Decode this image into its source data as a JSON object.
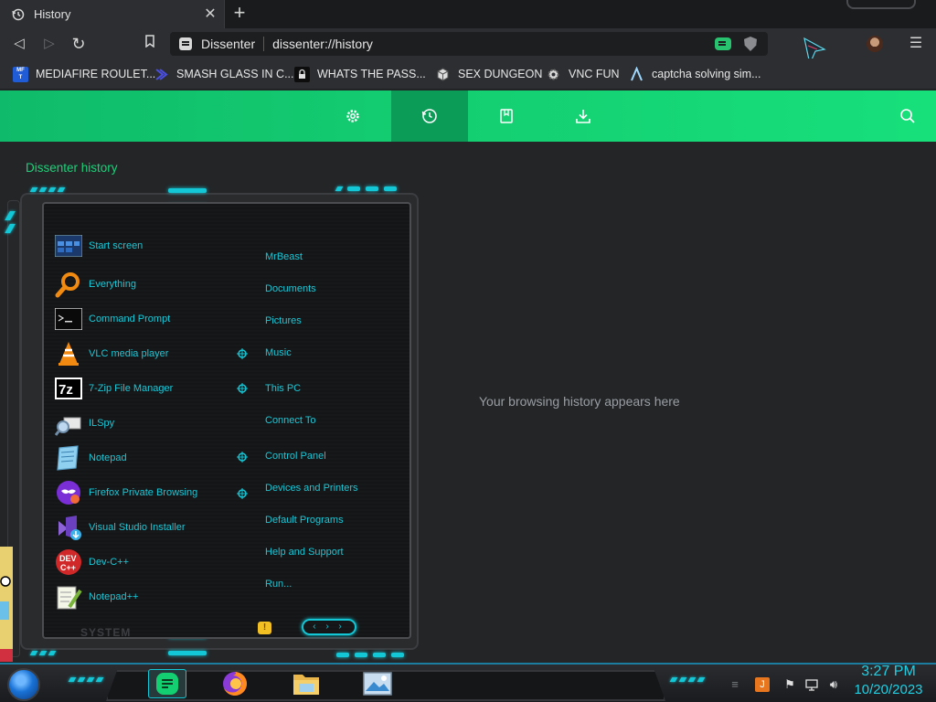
{
  "tab": {
    "title": "History",
    "close_glyph": "✕",
    "icon": "history-icon"
  },
  "new_tab_glyph": "+",
  "nav": {
    "back": "◁",
    "forward": "▷",
    "reload": "↻",
    "bookmark": "bookmark-icon"
  },
  "address": {
    "site_name": "Dissenter",
    "url": "dissenter://history"
  },
  "menu_glyph": "☰",
  "bookmarks": [
    {
      "label": "MEDIAFIRE ROULET...",
      "icon": "mediafire-icon",
      "icon_text": "MF\nT",
      "color": "#1f5cd6"
    },
    {
      "label": "SMASH GLASS IN C...",
      "icon": "visual-studio-icon",
      "icon_text": "",
      "color": "#3b3fd1"
    },
    {
      "label": "WHATS THE PASS...",
      "icon": "lock-icon",
      "icon_text": "",
      "color": "#111111"
    },
    {
      "label": "SEX DUNGEON",
      "icon": "cube-icon",
      "icon_text": "",
      "color": "#d9d9d9"
    },
    {
      "label": "VNC FUN",
      "icon": "gear-icon",
      "icon_text": "",
      "color": "#d9d9d9"
    },
    {
      "label": "captcha solving sim...",
      "icon": "a-logo-icon",
      "icon_text": "",
      "color": "#9fd8ff"
    }
  ],
  "green_nav": [
    {
      "name": "settings",
      "icon": "gear-icon",
      "active": false
    },
    {
      "name": "history",
      "icon": "history-icon",
      "active": true
    },
    {
      "name": "bookmarks",
      "icon": "bookmark-icon",
      "active": false
    },
    {
      "name": "downloads",
      "icon": "download-icon",
      "active": false
    }
  ],
  "page": {
    "heading": "Dissenter history",
    "empty_message": "Your browsing history appears here"
  },
  "start_menu": {
    "programs": [
      {
        "label": "Start screen",
        "icon": "start-screen-icon"
      },
      {
        "label": "Everything",
        "icon": "magnifier-icon"
      },
      {
        "label": "Command Prompt",
        "icon": "terminal-icon"
      },
      {
        "label": "VLC media player",
        "icon": "vlc-cone-icon"
      },
      {
        "label": "7-Zip File Manager",
        "icon": "7zip-icon"
      },
      {
        "label": "ILSpy",
        "icon": "ilspy-icon"
      },
      {
        "label": "Notepad",
        "icon": "notepad-icon"
      },
      {
        "label": "Firefox Private Browsing",
        "icon": "firefox-private-icon"
      },
      {
        "label": "Visual Studio Installer",
        "icon": "visual-studio-installer-icon"
      },
      {
        "label": "Dev-C++",
        "icon": "devcpp-icon"
      },
      {
        "label": "Notepad++",
        "icon": "notepadpp-icon"
      }
    ],
    "places": [
      {
        "label": "MrBeast",
        "has_arrow": false
      },
      {
        "label": "Documents",
        "has_arrow": false
      },
      {
        "label": "Pictures",
        "has_arrow": false
      },
      {
        "label": "Music",
        "has_arrow": true
      },
      {
        "label": "This PC",
        "has_arrow": true
      },
      {
        "label": "Connect To",
        "has_arrow": false
      },
      {
        "label": "Control Panel",
        "has_arrow": true
      },
      {
        "label": "Devices and Printers",
        "has_arrow": true
      },
      {
        "label": "Default Programs",
        "has_arrow": false
      },
      {
        "label": "Help and Support",
        "has_arrow": false
      },
      {
        "label": "Run...",
        "has_arrow": false
      }
    ],
    "system_label": "SYSTEM",
    "power_glyph": "!",
    "nav_glyphs": "‹ › ›"
  },
  "taskbar": {
    "apps": [
      {
        "name": "dissenter",
        "icon": "dissenter-icon",
        "active": true
      },
      {
        "name": "firefox",
        "icon": "firefox-icon",
        "active": false
      },
      {
        "name": "file-explorer",
        "icon": "folder-icon",
        "active": false
      },
      {
        "name": "photos",
        "icon": "photo-icon",
        "active": false
      }
    ],
    "clock_time": "3:27 PM",
    "clock_date": "10/20/2023"
  },
  "colors": {
    "accent_green": "#14cf72",
    "accent_cyan": "#14c7d6",
    "page_bg": "#232527"
  }
}
